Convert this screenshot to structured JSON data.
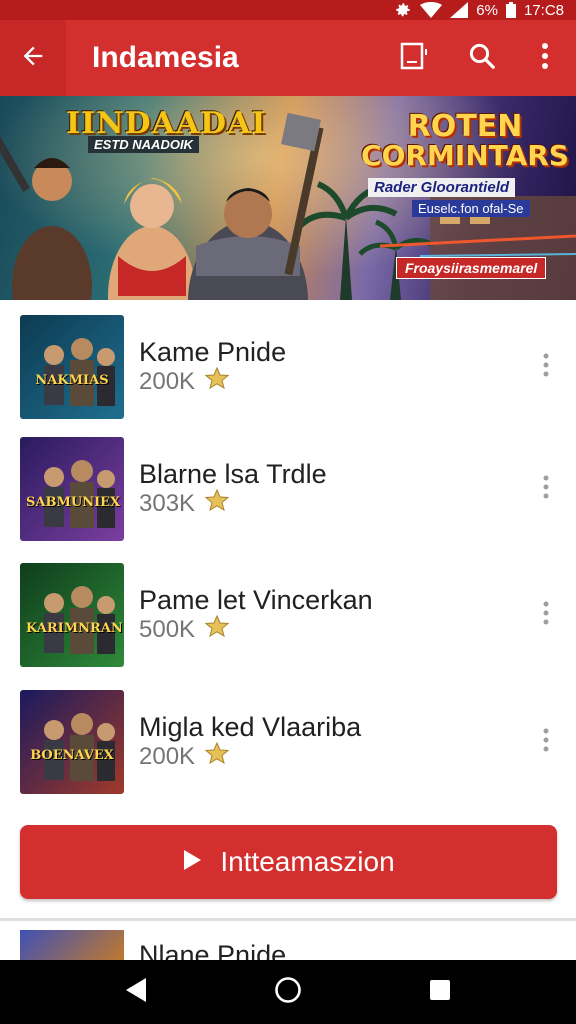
{
  "status_bar": {
    "battery": "6%",
    "time": "17:C8"
  },
  "app_bar": {
    "title": "Indamesia"
  },
  "banner": {
    "left_title": "IINDAADAI",
    "left_subtitle": "ESTD NAADOIK",
    "right_title_line1": "ROTEN",
    "right_title_line2": "CORMINTARS",
    "right_tag1": "Rader Gloorantield",
    "right_tag2": "Euselc.fon ofal-Se",
    "right_ribbon": "Froaysiirasmemarel"
  },
  "games": [
    {
      "title": "Kame Pnide",
      "count": "200K",
      "thumb_label": "NAKMIAS",
      "thumb_colors": [
        "#0d3b52",
        "#1f6f8f"
      ]
    },
    {
      "title": "Blarne lsa Trdle",
      "count": "303K",
      "thumb_label": "SABMUNIEX",
      "thumb_colors": [
        "#2a1b5e",
        "#7b3fa0"
      ]
    },
    {
      "title": "Pame let Vincerkan",
      "count": "500K",
      "thumb_label": "KARIMNRAN",
      "thumb_colors": [
        "#0f3d1c",
        "#2f8a3a"
      ]
    },
    {
      "title": "Migla ked Vlaariba",
      "count": "200K",
      "thumb_label": "BOENAVEX",
      "thumb_colors": [
        "#1a1a5e",
        "#a03a2a"
      ]
    }
  ],
  "cta": {
    "label": "Intteamaszion"
  },
  "peek_item": {
    "title": "Nlane Pnide"
  },
  "colors": {
    "primary": "#d32f2f",
    "primary_dark": "#b71c1c",
    "star": "#e6c15a"
  },
  "icons": {
    "status": [
      "gear-icon",
      "wifi-icon",
      "signal-icon",
      "battery-icon"
    ],
    "app_bar": [
      "back-arrow-icon",
      "cast-icon",
      "search-icon",
      "more-vert-icon"
    ],
    "nav": [
      "back-triangle-icon",
      "home-circle-icon",
      "recents-square-icon"
    ]
  }
}
